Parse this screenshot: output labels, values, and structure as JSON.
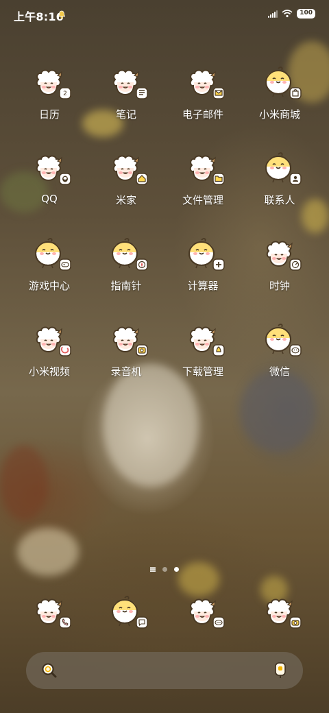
{
  "status_bar": {
    "time": "上午8:16",
    "battery": "100"
  },
  "apps": [
    {
      "label": "日历",
      "mascot": "sheep",
      "badge": "calendar-icon"
    },
    {
      "label": "笔记",
      "mascot": "sheep",
      "badge": "notes-icon"
    },
    {
      "label": "电子邮件",
      "mascot": "sheep",
      "badge": "mail-icon"
    },
    {
      "label": "小米商城",
      "mascot": "chick",
      "badge": "shopping-bag-icon"
    },
    {
      "label": "QQ",
      "mascot": "sheep",
      "badge": "qq-icon"
    },
    {
      "label": "米家",
      "mascot": "sheep",
      "badge": "home-icon"
    },
    {
      "label": "文件管理",
      "mascot": "sheep",
      "badge": "folder-icon"
    },
    {
      "label": "联系人",
      "mascot": "chick",
      "badge": "contacts-icon"
    },
    {
      "label": "游戏中心",
      "mascot": "chick",
      "badge": "gamepad-icon"
    },
    {
      "label": "指南针",
      "mascot": "chick",
      "badge": "compass-icon"
    },
    {
      "label": "计算器",
      "mascot": "chick",
      "badge": "calculator-icon"
    },
    {
      "label": "时钟",
      "mascot": "sheep",
      "badge": "clock-icon"
    },
    {
      "label": "小米视频",
      "mascot": "sheep",
      "badge": "video-icon"
    },
    {
      "label": "录音机",
      "mascot": "sheep",
      "badge": "recorder-icon"
    },
    {
      "label": "下载管理",
      "mascot": "sheep",
      "badge": "download-icon"
    },
    {
      "label": "微信",
      "mascot": "chick",
      "badge": "wechat-icon"
    }
  ],
  "dock": [
    {
      "mascot": "sheep",
      "badge": "phone-icon"
    },
    {
      "mascot": "chick",
      "badge": "messages-icon"
    },
    {
      "mascot": "sheep",
      "badge": "chat-icon"
    },
    {
      "mascot": "sheep",
      "badge": "camera-icon"
    }
  ],
  "page_indicator": {
    "pages": 2,
    "active": 2
  },
  "colors": {
    "sheep_wool": "#ffffff",
    "sheep_face": "#ffe9df",
    "chick_body": "#ffe07a",
    "icon_outline": "#4a3a25",
    "badge_yellow": "#ffd54f"
  }
}
